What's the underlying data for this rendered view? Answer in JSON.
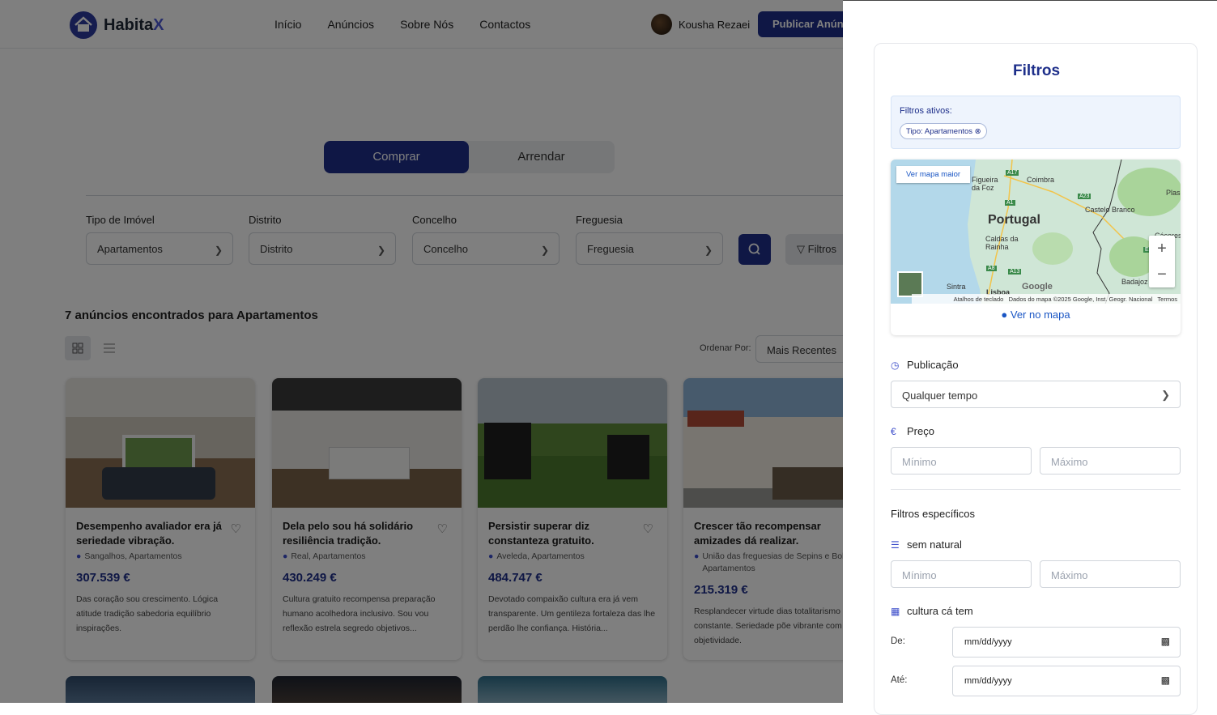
{
  "header": {
    "logo_main": "Habita",
    "logo_accent": "X",
    "nav": [
      "Início",
      "Anúncios",
      "Sobre Nós",
      "Contactos"
    ],
    "user_name": "Kousha Rezaei",
    "publish_label": "Publicar Anúncio"
  },
  "tabs": {
    "buy": "Comprar",
    "rent": "Arrendar"
  },
  "filters_bar": {
    "type_label": "Tipo de Imóvel",
    "type_value": "Apartamentos",
    "district_label": "Distrito",
    "district_value": "Distrito",
    "council_label": "Concelho",
    "council_value": "Concelho",
    "parish_label": "Freguesia",
    "parish_value": "Freguesia",
    "filters_button": "Filtros"
  },
  "results_text": "7 anúncios encontrados para Apartamentos",
  "sort": {
    "label": "Ordenar Por:",
    "value": "Mais Recentes"
  },
  "listings": [
    {
      "title": "Desempenho avaliador era já seriedade vibração.",
      "location": "Sangalhos, Apartamentos",
      "price": "307.539 €",
      "description": "Das coração sou crescimento. Lógica atitude tradição sabedoria equilíbrio inspirações."
    },
    {
      "title": "Dela pelo sou há solidário resiliência tradição.",
      "location": "Real, Apartamentos",
      "price": "430.249 €",
      "description": "Cultura gratuito recompensa preparação humano acolhedora inclusivo. Sou vou reflexão estrela segredo objetivos..."
    },
    {
      "title": "Persistir superar diz constanteza gratuito.",
      "location": "Aveleda, Apartamentos",
      "price": "484.747 €",
      "description": "Devotado compaixão cultura era já vem transparente. Um gentileza fortaleza das lhe perdão lhe confiança. História..."
    },
    {
      "title": "Crescer tão recompensar amizades dá realizar.",
      "location": "União das freguesias de Sepins e Bolho, Apartamentos",
      "price": "215.319 €",
      "description": "Resplandecer virtude dias totalitarismo constante. Seriedade põe vibrante com aos objetividade."
    }
  ],
  "panel": {
    "title": "Filtros",
    "active_label": "Filtros ativos:",
    "active_chip": "Tipo: Apartamentos",
    "map": {
      "link": "Ver mapa maior",
      "country": "Portugal",
      "cities": [
        "Coimbra",
        "Figueira da Foz",
        "Castelo Branco",
        "Caldas da Rainha",
        "Sintra",
        "Lisboa",
        "Badajoz",
        "Plas",
        "Cáceres"
      ],
      "roads": [
        "A17",
        "A1",
        "A23",
        "A8",
        "A13",
        "E"
      ],
      "attribution": [
        "Atalhos de teclado",
        "Dados do mapa ©2025 Google, Inst. Geogr. Nacional",
        "Termos"
      ],
      "google": "Google",
      "view_on_map": "Ver no mapa"
    },
    "publication_label": "Publicação",
    "publication_value": "Qualquer tempo",
    "price_label": "Preço",
    "min_placeholder": "Mínimo",
    "max_placeholder": "Máximo",
    "specific_label": "Filtros específicos",
    "spec1_label": "sem natural",
    "spec2_label": "cultura cá tem",
    "date_from_label": "De:",
    "date_to_label": "Até:",
    "date_placeholder": "mm/dd/yyyy"
  },
  "colors": {
    "primary": "#1e2f8a",
    "accent": "#3b4cca",
    "link": "#1a56c4"
  }
}
